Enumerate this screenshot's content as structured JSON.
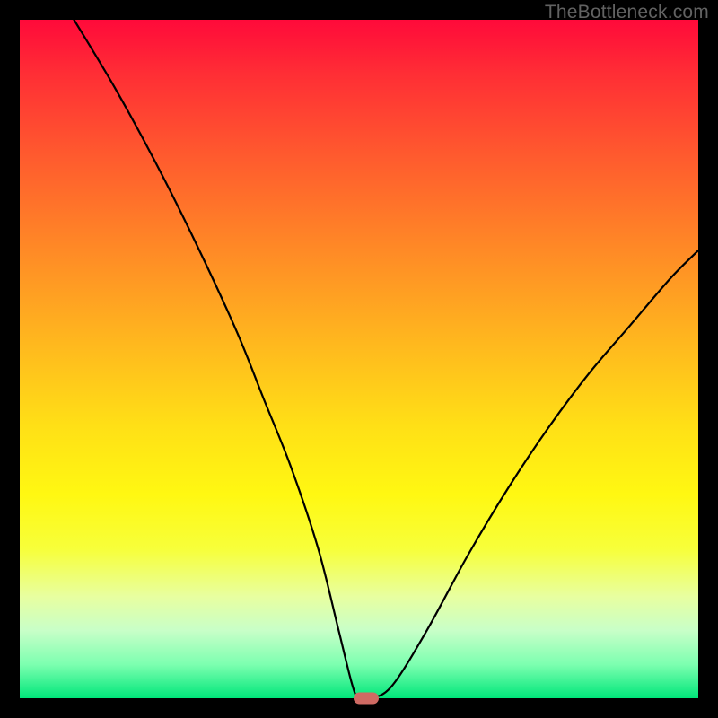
{
  "watermark": "TheBottleneck.com",
  "chart_data": {
    "type": "line",
    "title": "",
    "xlabel": "",
    "ylabel": "",
    "xlim": [
      0,
      100
    ],
    "ylim": [
      0,
      100
    ],
    "grid": false,
    "legend": false,
    "background": "rainbow-gradient-red-to-green",
    "series": [
      {
        "name": "bottleneck-curve",
        "x": [
          8,
          14,
          20,
          26,
          32,
          36,
          40,
          44,
          47,
          49,
          50,
          52,
          55,
          60,
          66,
          72,
          78,
          84,
          90,
          96,
          100
        ],
        "y": [
          100,
          90,
          79,
          67,
          54,
          44,
          34,
          22,
          10,
          2,
          0,
          0,
          2,
          10,
          21,
          31,
          40,
          48,
          55,
          62,
          66
        ]
      }
    ],
    "marker": {
      "x": 51,
      "y": 0,
      "color": "#cf6a63",
      "shape": "pill"
    }
  }
}
